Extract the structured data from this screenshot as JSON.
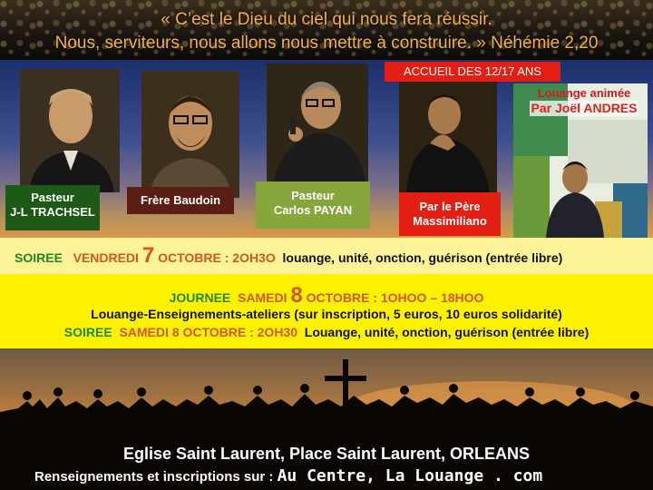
{
  "header": {
    "quote_line1": "« C’est le Dieu du ciel qui nous fera réussir.",
    "quote_line2": "Nous, serviteurs, nous allons nous mettre à construire. » Néhémie 2,20"
  },
  "speakers": {
    "s1": {
      "line1": "Pasteur",
      "line2": "J-L TRACHSEL"
    },
    "s2": {
      "line1": "Frère Baudoin"
    },
    "s3": {
      "line1": "Pasteur",
      "line2": "Carlos PAYAN"
    },
    "s4": {
      "line1": "Par le Père",
      "line2": "Massimiliano"
    },
    "accueil": "ACCUEIL DES 12/17 ANS",
    "louange_line1": "Louange animée",
    "louange_line2": "Par Joël ANDRES"
  },
  "event1": {
    "kind": "SOIREE",
    "day": "VENDREDI",
    "date_num": "7",
    "month_time": "OCTOBRE : 2OH3O",
    "desc": "louange, unité, onction, guérison (entrée libre)"
  },
  "event2": {
    "kind": "JOURNEE",
    "day": "SAMEDI",
    "date_num": "8",
    "month": "OCTOBRE",
    "time": ": 1OHOO – 18HOO",
    "desc": "Louange-Enseignements-ateliers  (sur inscription, 5 euros, 10 euros solidarité)"
  },
  "event3": {
    "kind": "SOIREE",
    "when": "SAMEDI 8 OCTOBRE : 2OH30",
    "desc": "Louange, unité, onction, guérison (entrée libre)"
  },
  "footer": {
    "venue": "Eglise Saint Laurent, Place Saint Laurent, ORLEANS",
    "info_label": "Renseignements et inscriptions sur :",
    "site": "Au Centre, La Louange . com"
  },
  "colors": {
    "accent_red": "#e31f14",
    "green": "#1f8a1f",
    "orange": "#d2571b",
    "yellow": "#fff200"
  }
}
